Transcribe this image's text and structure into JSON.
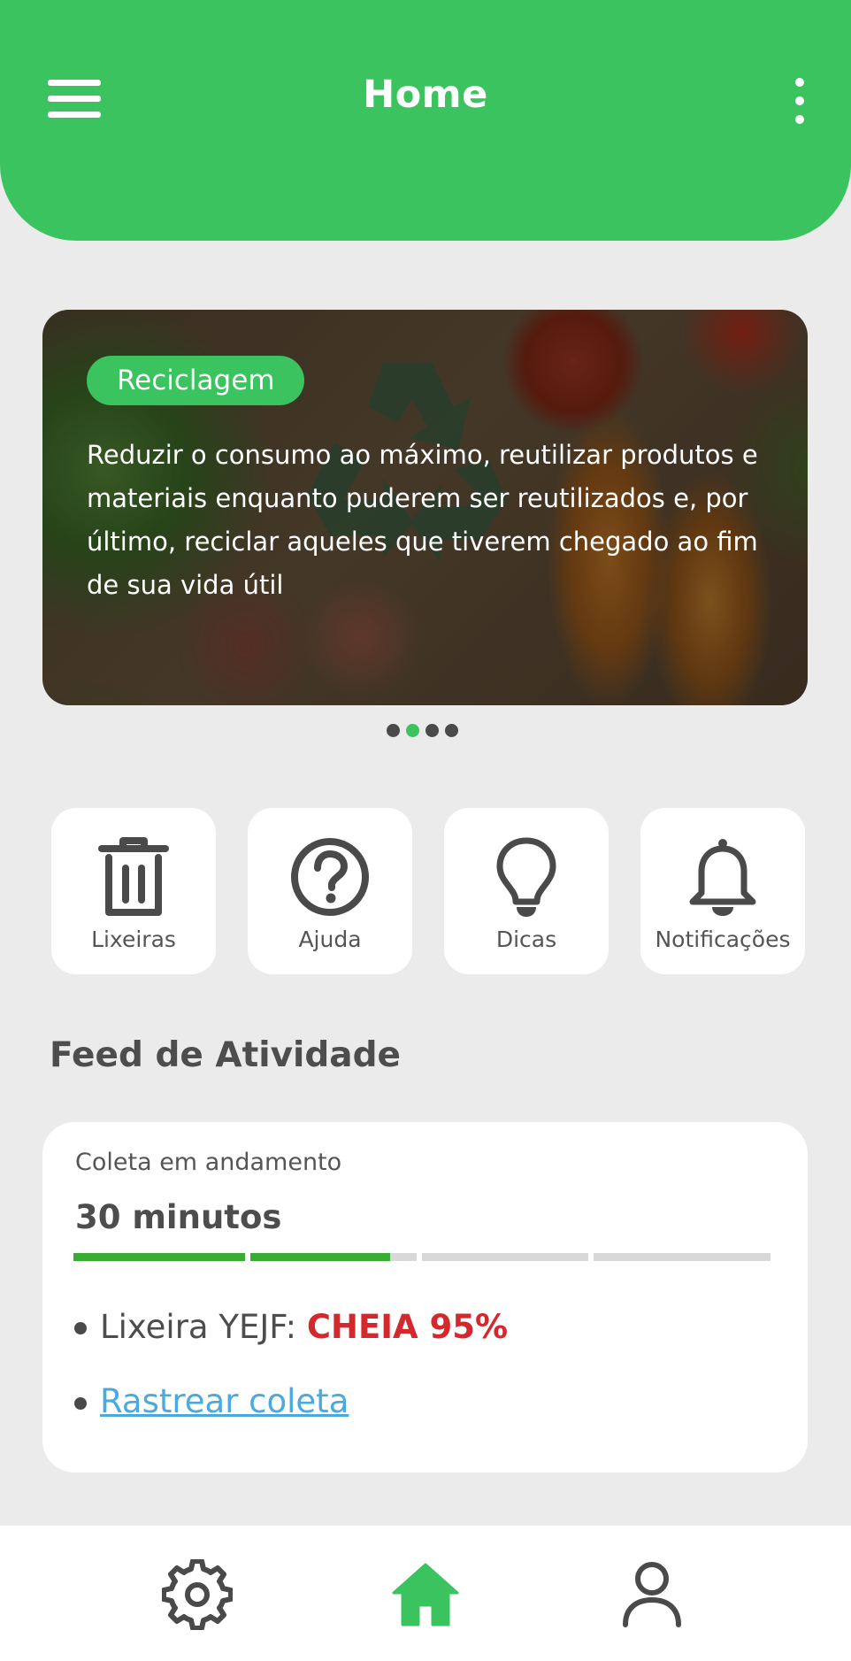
{
  "header": {
    "title": "Home"
  },
  "banner": {
    "tag": "Reciclagem",
    "text": "Reduzir o consumo ao máximo, reutilizar produtos e materiais enquanto puderem ser reutilizados e, por último, reciclar aqueles que tiverem chegado ao fim de sua vida útil",
    "pages": 4,
    "active_page": 2
  },
  "quick_actions": [
    {
      "label": "Lixeiras",
      "icon": "trash-icon"
    },
    {
      "label": "Ajuda",
      "icon": "help-icon"
    },
    {
      "label": "Dicas",
      "icon": "lightbulb-icon"
    },
    {
      "label": "Notificações",
      "icon": "bell-icon"
    }
  ],
  "feed": {
    "title": "Feed de Atividade",
    "card": {
      "status_label": "Coleta em andamento",
      "time": "30 minutos",
      "progress": {
        "segments": 4,
        "completed_segments": 1.84
      },
      "bin_label": "Lixeira YEJF:",
      "bin_status": "CHEIA 95%",
      "track_link": "Rastrear coleta"
    }
  },
  "bottom_nav": [
    {
      "icon": "gear-icon",
      "active": false
    },
    {
      "icon": "home-icon",
      "active": true
    },
    {
      "icon": "user-icon",
      "active": false
    }
  ],
  "colors": {
    "primary": "#3bc35f",
    "progress": "#3aab32",
    "alert": "#d3282c",
    "link": "#4aa9dd"
  }
}
